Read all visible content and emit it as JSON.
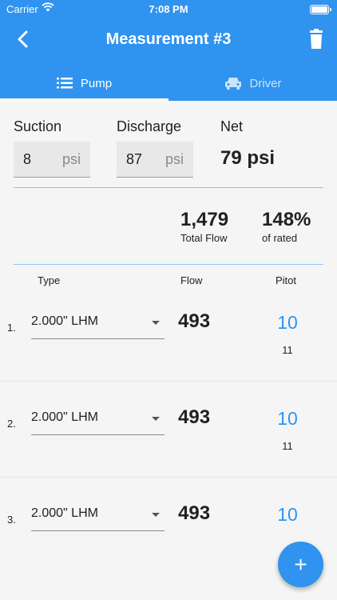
{
  "status_bar": {
    "carrier": "Carrier",
    "time": "7:08 PM"
  },
  "header": {
    "title": "Measurement #3",
    "back_icon": "chevron-left-icon",
    "delete_icon": "trash-icon",
    "color": "#2f93ef"
  },
  "tabs": [
    {
      "label": "Pump",
      "icon": "list-icon",
      "selected": true
    },
    {
      "label": "Driver",
      "icon": "car-icon",
      "selected": false
    }
  ],
  "pressure": {
    "suction": {
      "label": "Suction",
      "value": "8",
      "unit": "psi"
    },
    "discharge": {
      "label": "Discharge",
      "value": "87",
      "unit": "psi"
    },
    "net": {
      "label": "Net",
      "value": "79 psi"
    }
  },
  "totals": {
    "total_flow": {
      "value": "1,479",
      "label": "Total Flow"
    },
    "percent_rated": {
      "value": "148%",
      "label": "of rated"
    }
  },
  "columns": {
    "type": "Type",
    "flow": "Flow",
    "pitot": "Pitot"
  },
  "rows": [
    {
      "index": "1.",
      "type": "2.000\" LHM",
      "flow": "493",
      "pitot": "10",
      "pitot_sub": "11"
    },
    {
      "index": "2.",
      "type": "2.000\" LHM",
      "flow": "493",
      "pitot": "10",
      "pitot_sub": "11"
    },
    {
      "index": "3.",
      "type": "2.000\" LHM",
      "flow": "493",
      "pitot": "10",
      "pitot_sub": ""
    }
  ],
  "fab": {
    "label": "+",
    "icon": "plus-icon"
  }
}
